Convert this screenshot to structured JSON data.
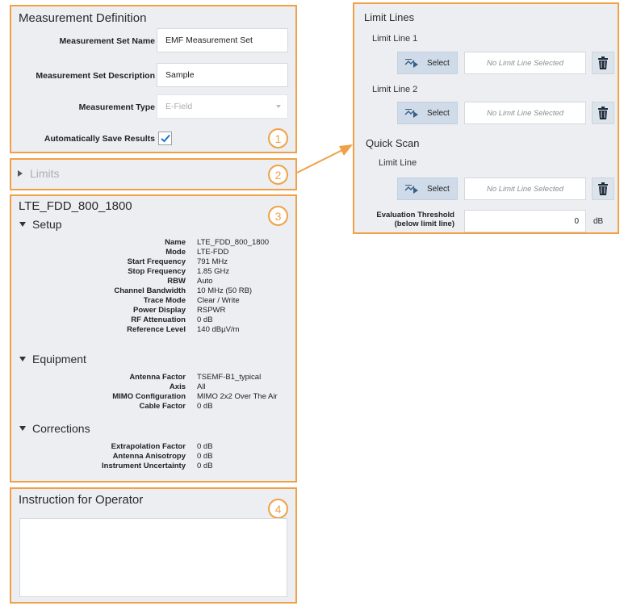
{
  "measurement_definition": {
    "title": "Measurement Definition",
    "set_name_label": "Measurement Set Name",
    "set_name_value": "EMF Measurement Set",
    "set_description_label": "Measurement Set Description",
    "set_description_value": "Sample",
    "type_label": "Measurement Type",
    "type_value": "E-Field",
    "auto_save_label": "Automatically Save Results",
    "auto_save_checked": true
  },
  "limits": {
    "label": "Limits"
  },
  "config": {
    "title": "LTE_FDD_800_1800",
    "setup": {
      "heading": "Setup",
      "rows": [
        {
          "key": "Name",
          "value": "LTE_FDD_800_1800"
        },
        {
          "key": "Mode",
          "value": "LTE-FDD"
        },
        {
          "key": "Start Frequency",
          "value": "791 MHz"
        },
        {
          "key": "Stop Frequency",
          "value": "1.85 GHz"
        },
        {
          "key": "RBW",
          "value": "Auto"
        },
        {
          "key": "Channel Bandwidth",
          "value": "10 MHz (50 RB)"
        },
        {
          "key": "Trace Mode",
          "value": "Clear / Write"
        },
        {
          "key": "Power Display",
          "value": "RSPWR"
        },
        {
          "key": "RF Attenuation",
          "value": "0 dB"
        },
        {
          "key": "Reference Level",
          "value": "140 dBµV/m"
        }
      ]
    },
    "equipment": {
      "heading": "Equipment",
      "rows": [
        {
          "key": "Antenna Factor",
          "value": "TSEMF-B1_typical"
        },
        {
          "key": "Axis",
          "value": "All"
        },
        {
          "key": "MIMO Configuration",
          "value": "MIMO 2x2 Over The Air"
        },
        {
          "key": "Cable Factor",
          "value": "0 dB"
        }
      ]
    },
    "corrections": {
      "heading": "Corrections",
      "rows": [
        {
          "key": "Extrapolation Factor",
          "value": "0 dB"
        },
        {
          "key": "Antenna Anisotropy",
          "value": "0 dB"
        },
        {
          "key": "Instrument Uncertainty",
          "value": "0 dB"
        }
      ]
    }
  },
  "instruction": {
    "title": "Instruction for Operator",
    "text": ""
  },
  "badges": [
    "1",
    "2",
    "3",
    "4"
  ],
  "limit_lines_panel": {
    "title": "Limit Lines",
    "limit_line_1_label": "Limit Line 1",
    "limit_line_2_label": "Limit Line 2",
    "quick_scan_title": "Quick Scan",
    "quick_scan_limit_label": "Limit Line",
    "select_label": "Select",
    "none_selected": "No Limit Line Selected",
    "threshold_label_line1": "Evaluation Threshold",
    "threshold_label_line2": "(below limit line)",
    "threshold_value": "0",
    "threshold_unit": "dB"
  },
  "icons": {
    "select": "limit-line-select-icon",
    "delete": "trash-icon",
    "checkbox": "checkmark-icon"
  },
  "colors": {
    "accent_orange": "#f0a147",
    "panel_bg": "#eceef1",
    "button_bg": "#cfdbe8",
    "check_blue": "#1a73c9"
  }
}
